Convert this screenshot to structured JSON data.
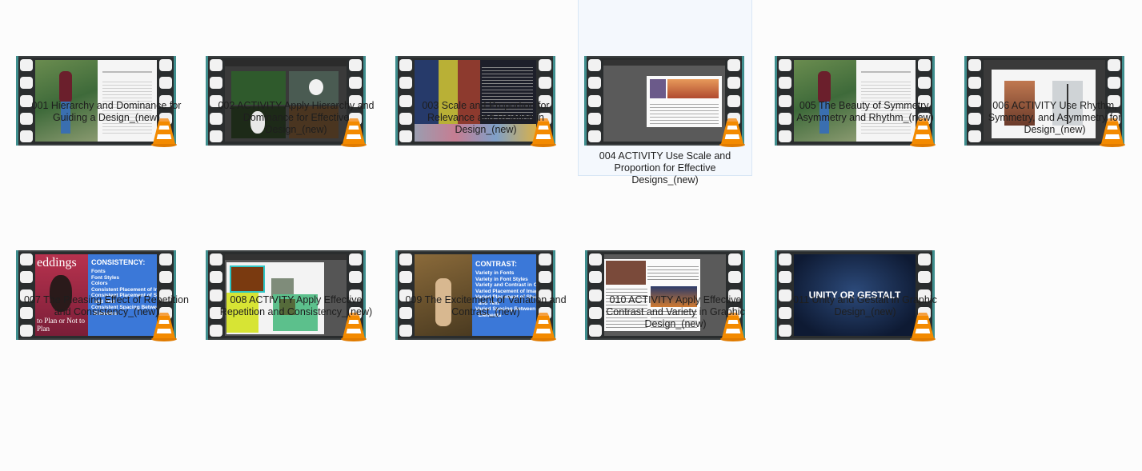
{
  "files": [
    {
      "label": "001 Hierarchy and Dominance for Guiding a Design_(new)"
    },
    {
      "label": "002 ACTIVITY Apply Hierarchy and Dominance for Effective Design_(new)"
    },
    {
      "label": "003 Scale and Proportion for Relevance and Relation in Design_(new)"
    },
    {
      "label": "004 ACTIVITY Use Scale and Proportion for Effective Designs_(new)"
    },
    {
      "label": "005 The Beauty of Symmetry, Asymmetry and Rhythm_(new)"
    },
    {
      "label": "006 ACTIVITY Use Rhythm, Symmetry, and Asymmetry for Design_(new)"
    },
    {
      "label": "007 The Pleasing Effect of Repetition and Consistency_(new)"
    },
    {
      "label": "008 ACTIVITY Apply Effective Repetition and Consistency_(new)"
    },
    {
      "label": "009 The Excitement of Variation and Contrast_(new)"
    },
    {
      "label": "010 ACTIVITY Apply Effective Contrast and Variety in Graphic Design_(new)"
    },
    {
      "label": "011 Unity and Gestalt in Graphic Design_(new)"
    }
  ],
  "thumbs": {
    "t007_title": "eddings",
    "t007_subtitle": "to Plan or Not to Plan",
    "t007_heading": "CONSISTENCY:",
    "t007_items": "Fonts\nFont Styles\nColors\nConsistent Placement of In\nConsistent Placement of Sh\n  and Text\nConsistent Spacing Betwee\n  Elements",
    "t009_heading": "CONTRAST:",
    "t009_items": "Variety in Fonts\nVariety in Font Styles\nVariety and Contrast in Col\nVaried Placement of Image\nVaried Placement of Shape\n  and Text\nVaried Spacing Between\n  Elements",
    "t011_text": "UNITY OR GESTALT"
  },
  "selected_index": 3,
  "icon": "vlc-cone-icon",
  "colors": {
    "film_edge": "#3f8e8e",
    "cone_orange": "#f08a00",
    "selection_bg": "#f4f8fd"
  }
}
